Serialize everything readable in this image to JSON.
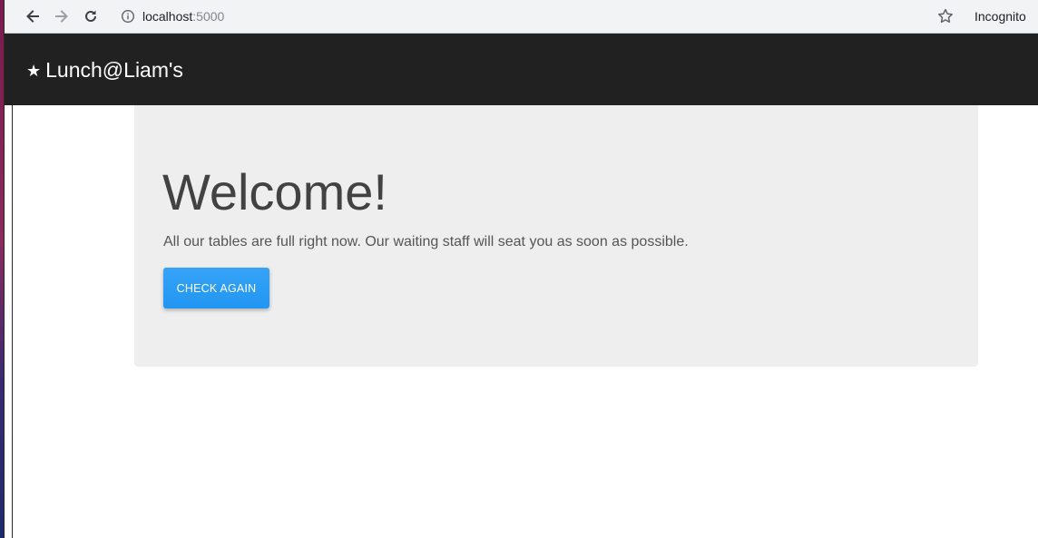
{
  "browser": {
    "url_host": "localhost",
    "url_port": ":5000",
    "mode_label": "Incognito",
    "icons": {
      "back": "back-arrow-icon",
      "forward": "forward-arrow-icon",
      "reload": "reload-icon",
      "info": "info-icon",
      "bookmark": "star-outline-icon"
    }
  },
  "app_bar": {
    "brand_icon": "★",
    "brand_name": "Lunch@Liam's",
    "background": "#212121"
  },
  "main": {
    "heading": "Welcome!",
    "message": "All our tables are full right now. Our waiting staff will seat you as soon as possible.",
    "check_button_label": "CHECK AGAIN",
    "accent_color": "#2196f3"
  }
}
